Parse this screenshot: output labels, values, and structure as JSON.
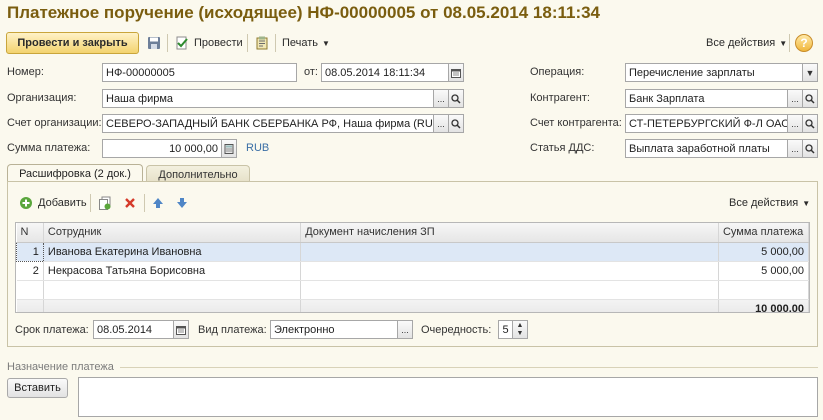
{
  "header": {
    "title": "Платежное поручение (исходящее) НФ-00000005 от 08.05.2014 18:11:34"
  },
  "toolbar": {
    "post_close_label": "Провести и закрыть",
    "post_label": "Провести",
    "print_label": "Печать",
    "all_actions_label": "Все действия",
    "help_label": "?"
  },
  "form": {
    "number_label": "Номер:",
    "number_value": "НФ-00000005",
    "date_label": "от:",
    "date_value": "08.05.2014 18:11:34",
    "operation_label": "Операция:",
    "operation_value": "Перечисление зарплаты",
    "org_label": "Организация:",
    "org_value": "Наша фирма",
    "counterparty_label": "Контрагент:",
    "counterparty_value": "Банк Зарплата",
    "org_account_label": "Счет организации:",
    "org_account_value": "СЕВЕРО-ЗАПАДНЫЙ БАНК СБЕРБАНКА РФ, Наша фирма (RUB)",
    "cp_account_label": "Счет контрагента:",
    "cp_account_value": "СТ-ПЕТЕРБУРГСКИЙ Ф-Л ОАО",
    "amount_label": "Сумма платежа:",
    "amount_value": "10 000,00",
    "currency": "RUB",
    "dds_label": "Статья ДДС:",
    "dds_value": "Выплата заработной платы"
  },
  "tabs": [
    {
      "label": "Расшифровка (2 док.)"
    },
    {
      "label": "Дополнительно"
    }
  ],
  "tab_toolbar": {
    "add_label": "Добавить",
    "all_actions_label": "Все действия"
  },
  "table": {
    "columns": [
      "N",
      "Сотрудник",
      "Документ начисления ЗП",
      "Сумма платежа"
    ],
    "rows": [
      {
        "n": "1",
        "employee": "Иванова Екатерина Ивановна",
        "doc": "",
        "sum": "5 000,00"
      },
      {
        "n": "2",
        "employee": "Некрасова Татьяна Борисовна",
        "doc": "",
        "sum": "5 000,00"
      }
    ],
    "total": "10 000,00"
  },
  "payment": {
    "due_label": "Срок платежа:",
    "due_value": "08.05.2014",
    "type_label": "Вид платежа:",
    "type_value": "Электронно",
    "order_label": "Очередность:",
    "order_value": "5"
  },
  "purpose": {
    "label": "Назначение платежа",
    "insert_label": "Вставить"
  },
  "colors": {
    "title": "#7a5d0f",
    "primary_button": "#f3d36f",
    "selected_row": "#dde8f6",
    "link_currency": "#3a6ea5"
  }
}
